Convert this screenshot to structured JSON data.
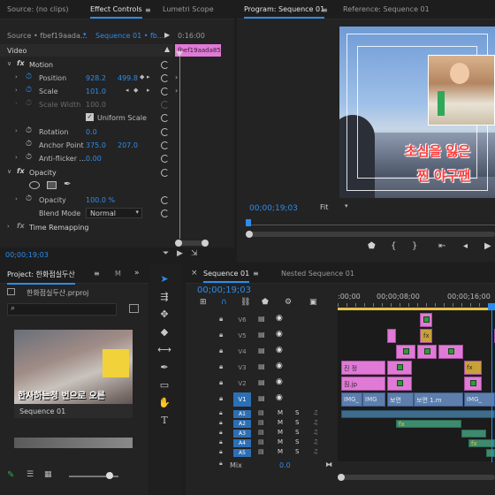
{
  "source_tabs": {
    "source": "Source: (no clips)",
    "effect_controls": "Effect Controls",
    "lumetri": "Lumetri Scope"
  },
  "effect_controls": {
    "source_name": "Source • fbef19aada...",
    "sequence_name": "Sequence 01 • fb...",
    "timecode_head": "0:16:00",
    "clip_label": "fbef19aada85",
    "video_header": "Video",
    "motion": "Motion",
    "position_label": "Position",
    "position_x": "928.2",
    "position_y": "499.8",
    "scale_label": "Scale",
    "scale_value": "101.0",
    "scale_width_label": "Scale Width",
    "scale_width_value": "100.0",
    "uniform_scale": "Uniform Scale",
    "rotation_label": "Rotation",
    "rotation_value": "0.0",
    "anchor_label": "Anchor Point",
    "anchor_x": "375.0",
    "anchor_y": "207.0",
    "antiflicker_label": "Anti-flicker ...",
    "antiflicker_value": "0.00",
    "opacity_section": "Opacity",
    "opacity_label": "Opacity",
    "opacity_value": "100.0 %",
    "blend_label": "Blend Mode",
    "blend_value": "Normal",
    "time_remap": "Time Remapping",
    "footer_timecode": "00;00;19;03"
  },
  "program": {
    "tab": "Program: Sequence 01",
    "reference_tab": "Reference: Sequence 01",
    "timecode": "00;00;19;03",
    "fit": "Fit",
    "subtitle_line1": "초심을 잃은",
    "subtitle_line2": "찐 야구팬"
  },
  "project": {
    "tab": "Project: 한화점실두산",
    "tab2": "M",
    "file": "한화점실두산.prproj",
    "thumb_caption": "Sequence 01",
    "thumb_sub": "한사하는청 번으로 오른"
  },
  "timeline": {
    "tab": "Sequence 01",
    "tab2": "Nested Sequence 01",
    "timecode": "00;00;19;03",
    "ruler_0": ":00;00",
    "ruler_1": "00;00;08;00",
    "ruler_2": "00;00;16;00",
    "tracks": [
      "V6",
      "V5",
      "V4",
      "V3",
      "V2",
      "V1",
      "A1",
      "A2",
      "A3",
      "A4",
      "A5"
    ],
    "mix_label": "Mix",
    "mix_value": "0.0",
    "clips": {
      "v3a": "진 정",
      "v2a": "짐.jp",
      "v1a": "IMG_",
      "v1b": "IMG",
      "v1c": "보면",
      "v1d": "보면 1.m",
      "v1e": "IMG_",
      "v4fx": "fx",
      "v3fx": "fx",
      "a3fx": "fx",
      "a1fx": "fx"
    }
  },
  "colors": {
    "accent": "#2d8ceb",
    "clip_pink": "#e07ad6",
    "clip_blue": "#5e7fae",
    "clip_green": "#3e8a6e",
    "subtitle_red": "#ff3a3a"
  }
}
